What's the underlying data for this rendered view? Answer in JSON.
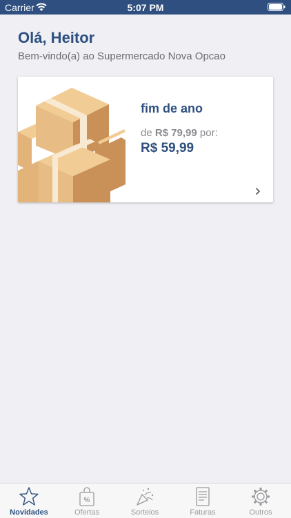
{
  "status_bar": {
    "carrier": "Carrier",
    "time": "5:07 PM"
  },
  "header": {
    "greeting": "Olá, Heitor",
    "welcome": "Bem-vindo(a) ao Supermercado Nova Opcao"
  },
  "offer": {
    "title": "fim de ano",
    "old_prefix": "de",
    "old_price": "R$ 79,99",
    "old_suffix": "por:",
    "new_price": "R$ 59,99",
    "image_icon": "cardboard-boxes"
  },
  "tabs": [
    {
      "label": "Novidades",
      "icon": "star-icon",
      "active": true
    },
    {
      "label": "Ofertas",
      "icon": "shopping-bag-percent-icon",
      "active": false
    },
    {
      "label": "Sorteios",
      "icon": "party-popper-icon",
      "active": false
    },
    {
      "label": "Faturas",
      "icon": "invoice-icon",
      "active": false
    },
    {
      "label": "Outros",
      "icon": "gear-icon",
      "active": false
    }
  ],
  "colors": {
    "primary": "#2e4f7f",
    "background": "#efeff4",
    "inactive": "#9a9a9e"
  }
}
